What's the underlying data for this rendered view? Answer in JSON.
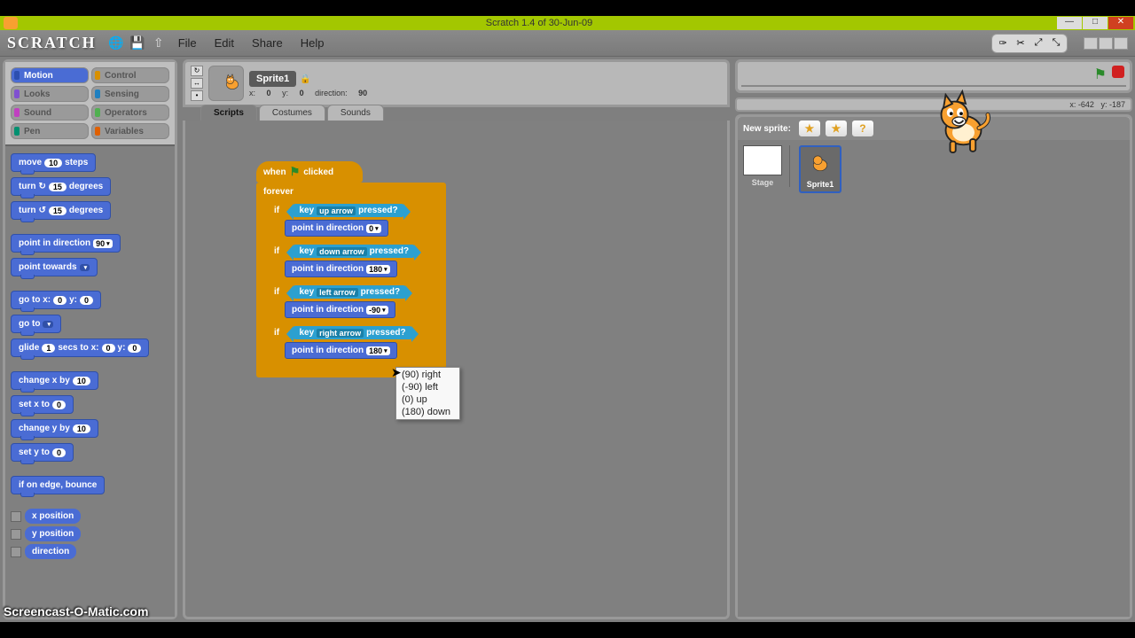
{
  "title": "Scratch 1.4 of 30-Jun-09",
  "logo": "SCRATCH",
  "menu": {
    "file": "File",
    "edit": "Edit",
    "share": "Share",
    "help": "Help"
  },
  "categories": {
    "motion": "Motion",
    "control": "Control",
    "looks": "Looks",
    "sensing": "Sensing",
    "sound": "Sound",
    "operators": "Operators",
    "pen": "Pen",
    "variables": "Variables"
  },
  "palette_blocks": {
    "move": {
      "pre": "move",
      "val": "10",
      "post": "steps"
    },
    "turncw": {
      "pre": "turn",
      "icon": "↻",
      "val": "15",
      "post": "degrees"
    },
    "turnccw": {
      "pre": "turn",
      "icon": "↺",
      "val": "15",
      "post": "degrees"
    },
    "pointdir": {
      "pre": "point in direction",
      "val": "90"
    },
    "pointtowards": {
      "pre": "point towards",
      "val": ""
    },
    "gotoxy": {
      "pre": "go to x:",
      "x": "0",
      "mid": "y:",
      "y": "0"
    },
    "goto": {
      "pre": "go to",
      "val": ""
    },
    "glide": {
      "pre": "glide",
      "s": "1",
      "mid1": "secs to x:",
      "x": "0",
      "mid2": "y:",
      "y": "0"
    },
    "changex": {
      "pre": "change x by",
      "val": "10"
    },
    "setx": {
      "pre": "set x to",
      "val": "0"
    },
    "changey": {
      "pre": "change y by",
      "val": "10"
    },
    "sety": {
      "pre": "set y to",
      "val": "0"
    },
    "bounce": "if on edge, bounce",
    "xpos": "x position",
    "ypos": "y position",
    "dir": "direction"
  },
  "sprite": {
    "name": "Sprite1",
    "pos": {
      "xlabel": "x:",
      "x": "0",
      "ylabel": "y:",
      "y": "0",
      "dirlabel": "direction:",
      "dir": "90"
    }
  },
  "tabs": {
    "scripts": "Scripts",
    "costumes": "Costumes",
    "sounds": "Sounds"
  },
  "script": {
    "hat": {
      "when": "when",
      "clicked": "clicked"
    },
    "forever": "forever",
    "if": "if",
    "key": "key",
    "pressed": "pressed?",
    "pointdir": "point in direction",
    "keys": {
      "up": "up arrow",
      "down": "down arrow",
      "left": "left arrow",
      "right": "right arrow"
    },
    "dirs": {
      "up": "0",
      "down": "180",
      "left": "-90",
      "right": "180"
    }
  },
  "dropdown": {
    "opt1": "(90) right",
    "opt2": "(-90) left",
    "opt3": "(0) up",
    "opt4": "(180) down"
  },
  "stage_coords": {
    "xlabel": "x:",
    "x": "-642",
    "ylabel": "y:",
    "y": "-187"
  },
  "sprites_panel": {
    "new": "New sprite:",
    "stage": "Stage",
    "sprite1": "Sprite1"
  },
  "watermark": "Screencast-O-Matic.com"
}
